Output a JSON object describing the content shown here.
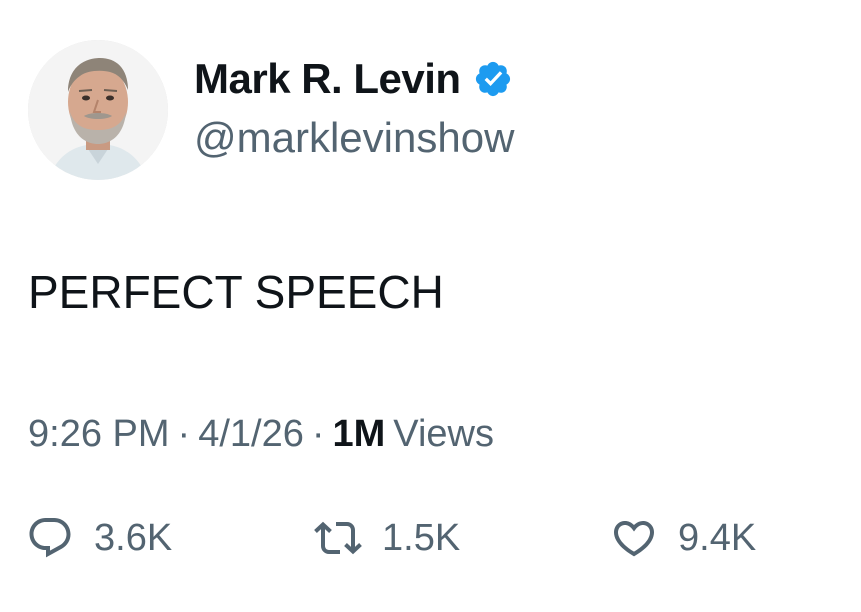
{
  "author": {
    "display_name": "Mark R. Levin",
    "handle": "@marklevinshow",
    "verified": true,
    "verified_color": "#1d9bf0"
  },
  "tweet": {
    "text": "PERFECT SPEECH"
  },
  "meta": {
    "time": "9:26 PM",
    "separator": "·",
    "date": "4/1/26",
    "views_count": "1M",
    "views_label": "Views"
  },
  "actions": {
    "reply": {
      "icon": "reply-icon",
      "count": "3.6K"
    },
    "retweet": {
      "icon": "retweet-icon",
      "count": "1.5K"
    },
    "like": {
      "icon": "heart-icon",
      "count": "9.4K"
    }
  },
  "colors": {
    "primary_text": "#0f1419",
    "secondary_text": "#536471",
    "icon": "#536471"
  }
}
